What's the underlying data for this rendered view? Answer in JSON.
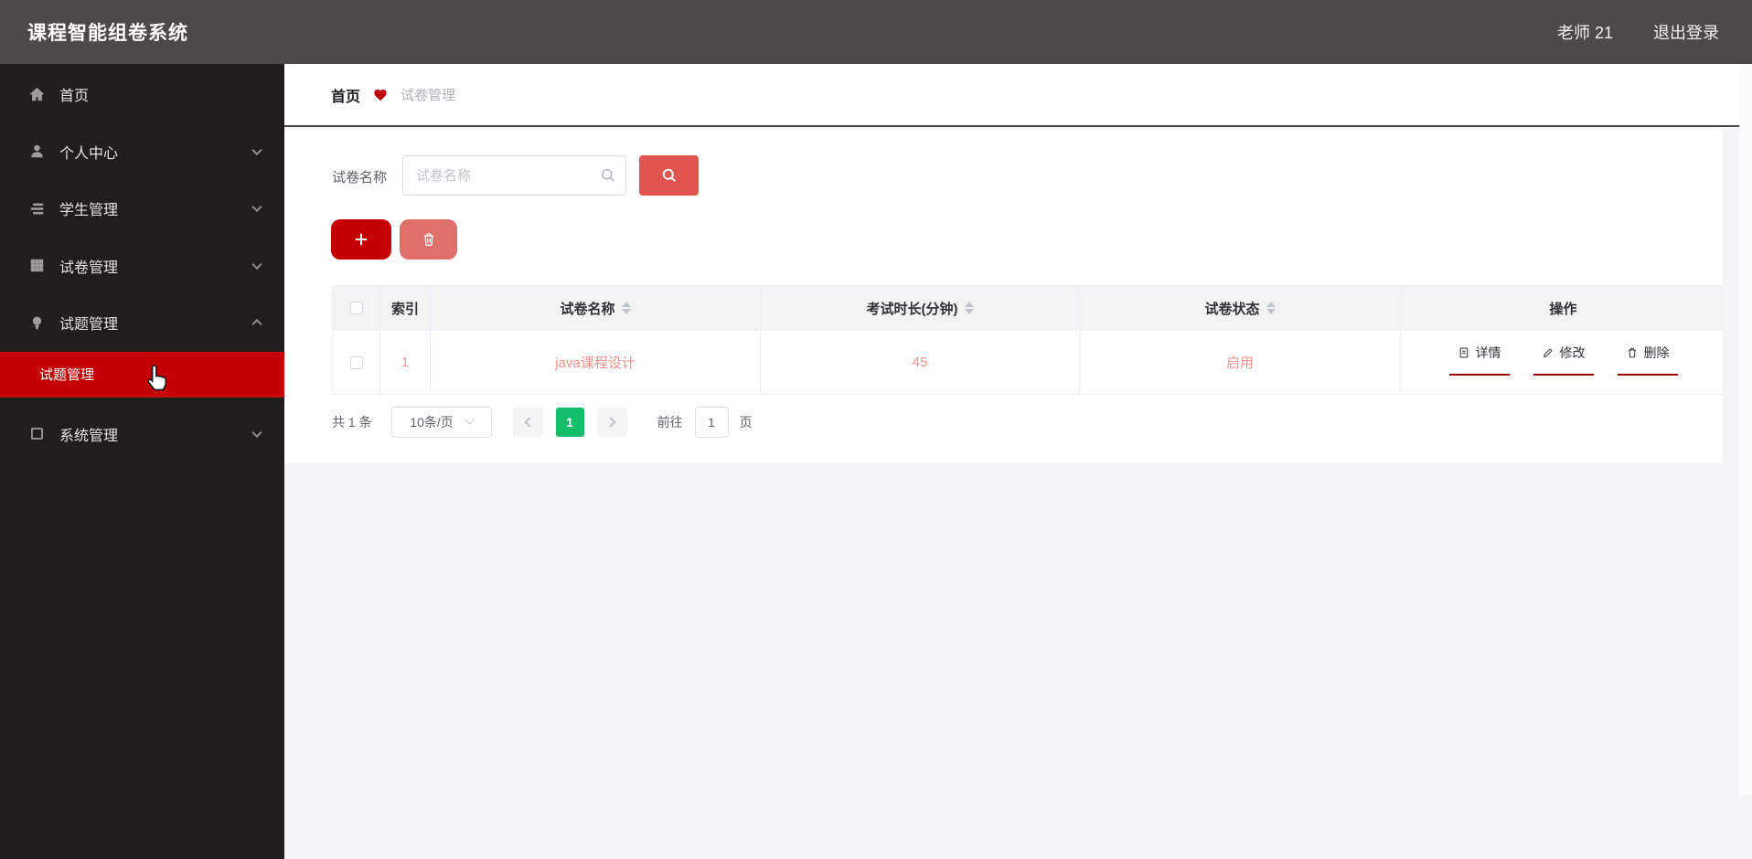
{
  "topbar": {
    "title": "课程智能组卷系统",
    "user": "老师 21",
    "logout": "退出登录"
  },
  "sidebar": {
    "items": [
      {
        "label": "首页",
        "icon": "home-icon",
        "chevron": "none"
      },
      {
        "label": "个人中心",
        "icon": "user-icon",
        "chevron": "down"
      },
      {
        "label": "学生管理",
        "icon": "list-icon",
        "chevron": "down"
      },
      {
        "label": "试卷管理",
        "icon": "grid-icon",
        "chevron": "down"
      },
      {
        "label": "试题管理",
        "icon": "bulb-icon",
        "chevron": "up"
      },
      {
        "label": "系统管理",
        "icon": "frame-icon",
        "chevron": "down"
      }
    ],
    "active_submenu": "试题管理"
  },
  "breadcrumb": {
    "home": "首页",
    "separator_icon": "heart-icon",
    "current": "试卷管理"
  },
  "filters": {
    "label": "试卷名称",
    "placeholder": "试卷名称"
  },
  "toolbar": {
    "add_icon": "plus-icon",
    "delete_icon": "trash-icon"
  },
  "table": {
    "columns": [
      "索引",
      "试卷名称",
      "考试时长(分钟)",
      "试卷状态",
      "操作"
    ],
    "sortable_columns": [
      "试卷名称",
      "考试时长(分钟)",
      "试卷状态"
    ],
    "rows": [
      {
        "index": "1",
        "name": "java课程设计",
        "duration": "45",
        "status": "启用"
      }
    ],
    "row_actions": {
      "detail": "详情",
      "edit": "修改",
      "delete": "删除"
    }
  },
  "pagination": {
    "total": "共 1 条",
    "page_size": "10条/页",
    "current_page": "1",
    "goto_label": "前往",
    "goto_value": "1",
    "page_unit": "页"
  },
  "colors": {
    "topbar_bg": "#4c4a47",
    "sidebar_bg": "#201e1d",
    "active_menu_red": "#c50005",
    "search_button_red": "#e0544f",
    "delete_button_red": "#de6f69",
    "row_text_salmon": "#f0908a",
    "action_underline_red": "#9c0005",
    "active_page_green": "#14bd68",
    "page_bg": "#f4f5f7"
  }
}
